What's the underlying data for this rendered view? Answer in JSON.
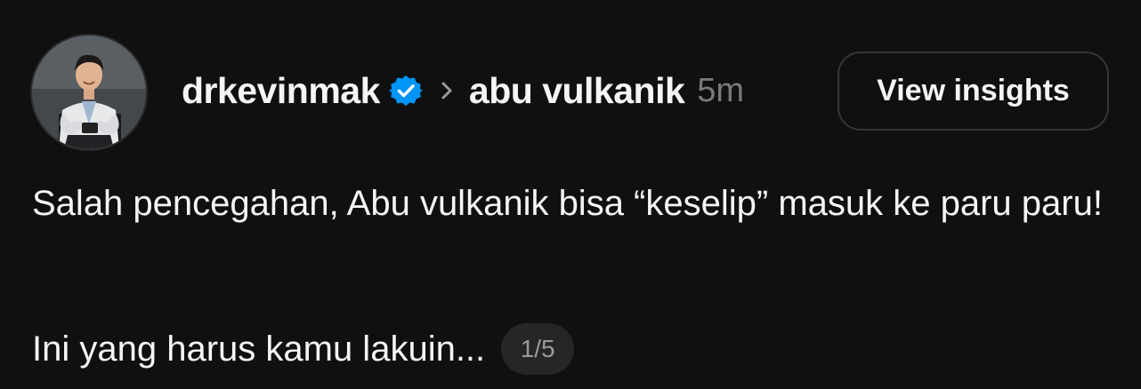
{
  "post": {
    "username": "drkevinmak",
    "verified_icon": "verified-badge-icon",
    "separator_icon": "chevron-right-icon",
    "topic": "abu vulkanik",
    "time_ago": "5m",
    "view_insights_label": "View insights",
    "text_paragraph_1": "Salah pencegahan, Abu vulkanik bisa “keselip” masuk ke paru paru!",
    "text_paragraph_2": "Ini yang harus kamu lakuin...",
    "media_counter": "1/5"
  },
  "colors": {
    "background": "#101010",
    "text_primary": "#f3f5f7",
    "text_secondary": "#7a7a7a",
    "verified_blue": "#0095f6",
    "button_border": "#363636",
    "counter_background": "#262626"
  }
}
